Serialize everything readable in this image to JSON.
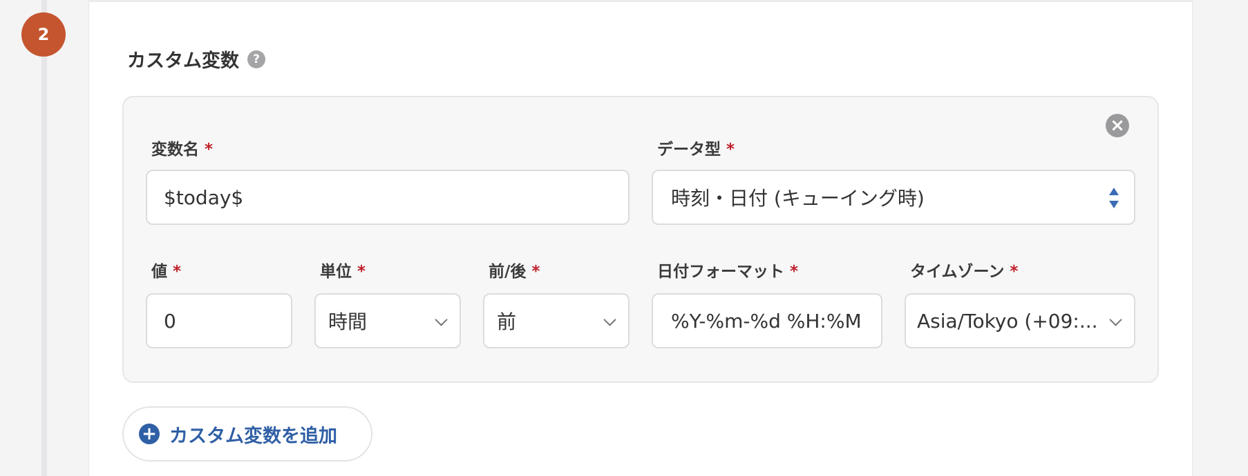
{
  "step": {
    "number": "2"
  },
  "section": {
    "title": "カスタム変数",
    "help_icon": "?"
  },
  "variable": {
    "remove_icon": "×",
    "name": {
      "label": "変数名",
      "required": "*",
      "value": "$today$"
    },
    "type": {
      "label": "データ型",
      "required": "*",
      "value": "時刻・日付 (キューイング時)"
    },
    "offset_value": {
      "label": "値",
      "required": "*",
      "value": "0"
    },
    "unit": {
      "label": "単位",
      "required": "*",
      "value": "時間"
    },
    "direction": {
      "label": "前/後",
      "required": "*",
      "value": "前"
    },
    "date_format": {
      "label": "日付フォーマット",
      "required": "*",
      "value": "%Y-%m-%d %H:%M"
    },
    "timezone": {
      "label": "タイムゾーン",
      "required": "*",
      "value": "Asia/Tokyo (+09:..."
    }
  },
  "add_button": {
    "icon": "+",
    "label": "カスタム変数を追加"
  },
  "colors": {
    "step_badge": "#c4552f",
    "required_mark": "#c0202a",
    "accent_blue": "#2f5fa5"
  }
}
